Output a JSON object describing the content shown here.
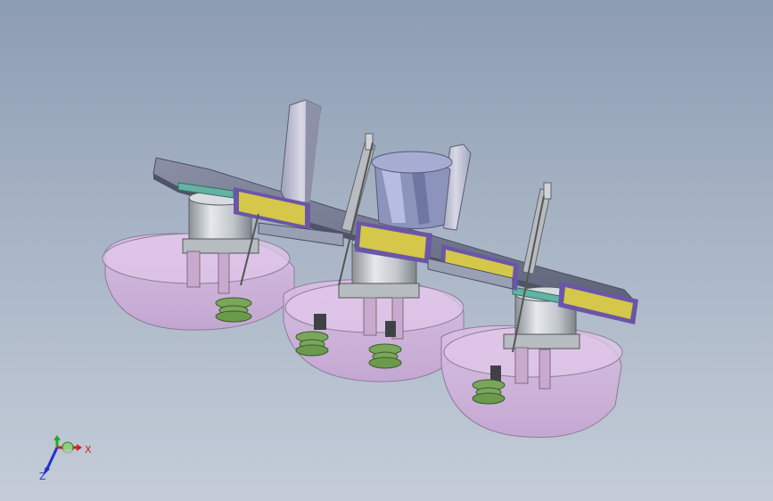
{
  "viewport": {
    "background_top": "#8c9cb2",
    "background_bottom": "#c4ccd8"
  },
  "model": {
    "icon": "mechanical-assembly-3d-model",
    "colors": {
      "plate": "#7a7f95",
      "plate_edge": "#5e6276",
      "bracket": "#c9c9d8",
      "label": "#d4c74a",
      "label_frame": "#6a56a8",
      "teal_plate": "#63b2a4",
      "transparent_disc": "#d7b7df",
      "cylinder": "#c7ccd0",
      "rod": "#9ea3a8",
      "suction_cup": "#7aa65a"
    }
  },
  "triad": {
    "icon": "coordinate-triad-icon",
    "x_label": "X",
    "z_label": "Z",
    "x_color": "#d42020",
    "y_color": "#22aa22",
    "z_color": "#2233cc"
  }
}
